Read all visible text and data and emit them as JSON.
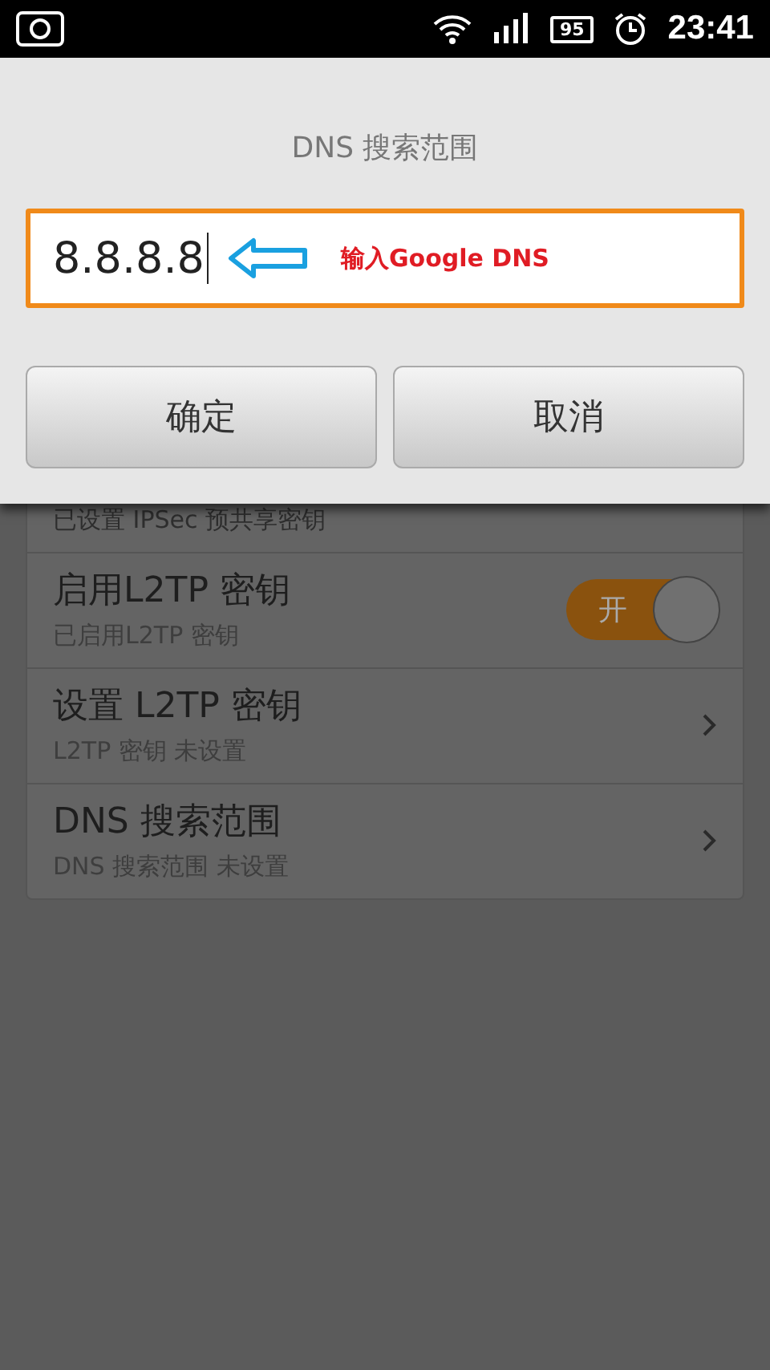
{
  "status_bar": {
    "battery": "95",
    "time": "23:41"
  },
  "dialog": {
    "title": "DNS 搜索范围",
    "field_value": "8.8.8.8",
    "annotation": "输入Google DNS",
    "buttons": [
      "确定",
      "取消"
    ]
  },
  "settings": [
    {
      "kind": "text",
      "subtitle": "已设置 IPSec 预共享密钥"
    },
    {
      "kind": "toggle",
      "title": "启用L2TP 密钥",
      "subtitle": "已启用L2TP 密钥",
      "on": true,
      "toggle_label": "开"
    },
    {
      "kind": "link",
      "title": "设置 L2TP 密钥",
      "subtitle": "L2TP 密钥 未设置"
    },
    {
      "kind": "link",
      "title": "DNS 搜索范围",
      "subtitle": "DNS 搜索范围 未设置"
    }
  ]
}
